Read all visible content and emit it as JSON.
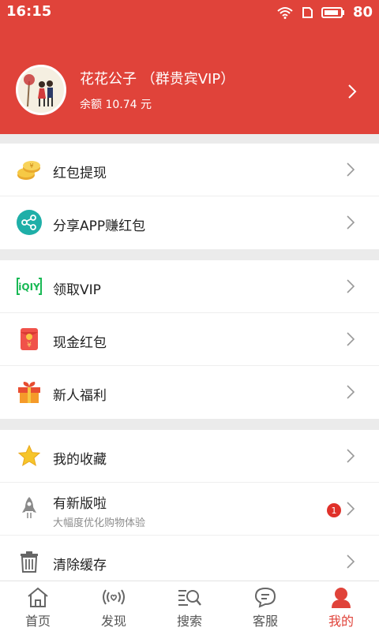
{
  "status_bar": {
    "time": "16:15",
    "battery": "80"
  },
  "profile": {
    "name": "花花公子 （群贵宾VIP）",
    "balance": "余额 10.74 元"
  },
  "groups": [
    {
      "items": [
        {
          "label": "红包提现",
          "icon": "coins-icon"
        },
        {
          "label": "分享APP赚红包",
          "icon": "share-icon"
        }
      ]
    },
    {
      "items": [
        {
          "label": "领取VIP",
          "icon": "iqiyi-logo-icon"
        },
        {
          "label": "现金红包",
          "icon": "red-envelope-icon"
        },
        {
          "label": "新人福利",
          "icon": "gift-icon"
        }
      ]
    },
    {
      "items": [
        {
          "label": "我的收藏",
          "icon": "star-icon"
        },
        {
          "label": "有新版啦",
          "sublabel": "大幅度优化购物体验",
          "badge": "1",
          "icon": "rocket-icon"
        },
        {
          "label": "清除缓存",
          "icon": "trash-icon"
        }
      ]
    }
  ],
  "tabs": [
    {
      "label": "首页",
      "icon": "home-icon"
    },
    {
      "label": "发现",
      "icon": "discover-icon"
    },
    {
      "label": "搜索",
      "icon": "search-icon"
    },
    {
      "label": "客服",
      "icon": "chat-icon"
    },
    {
      "label": "我的",
      "icon": "user-icon",
      "active": true
    }
  ],
  "colors": {
    "accent": "#e0433a",
    "background": "#ebebeb"
  }
}
